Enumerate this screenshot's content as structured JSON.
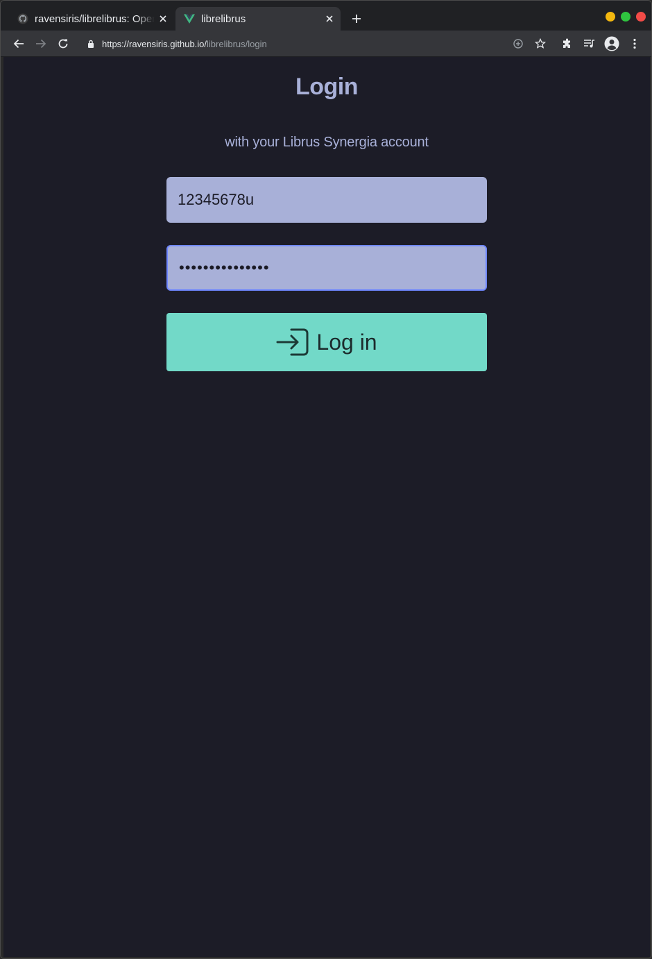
{
  "browser": {
    "tabs": [
      {
        "title": "ravensiris/librelibrus: Open",
        "favicon": "github-icon",
        "active": false
      },
      {
        "title": "librelibrus",
        "favicon": "vue-icon",
        "active": true
      }
    ],
    "url": {
      "scheme_host": "https://ravensiris.github.io/",
      "path": "librelibrus/login"
    },
    "colors": {
      "tabstrip": "#202124",
      "toolbar": "#35363a"
    }
  },
  "page": {
    "title": "Login",
    "subtitle": "with your Librus Synergia account",
    "username_value": "12345678u",
    "password_value": "•••••••••••••••",
    "login_button_label": "Log in",
    "colors": {
      "background": "#1c1c27",
      "accent_text": "#a8b0d8",
      "field_bg": "#a8b0d8",
      "focus_border": "#6e86ff",
      "button_bg": "#72d9c8"
    }
  }
}
